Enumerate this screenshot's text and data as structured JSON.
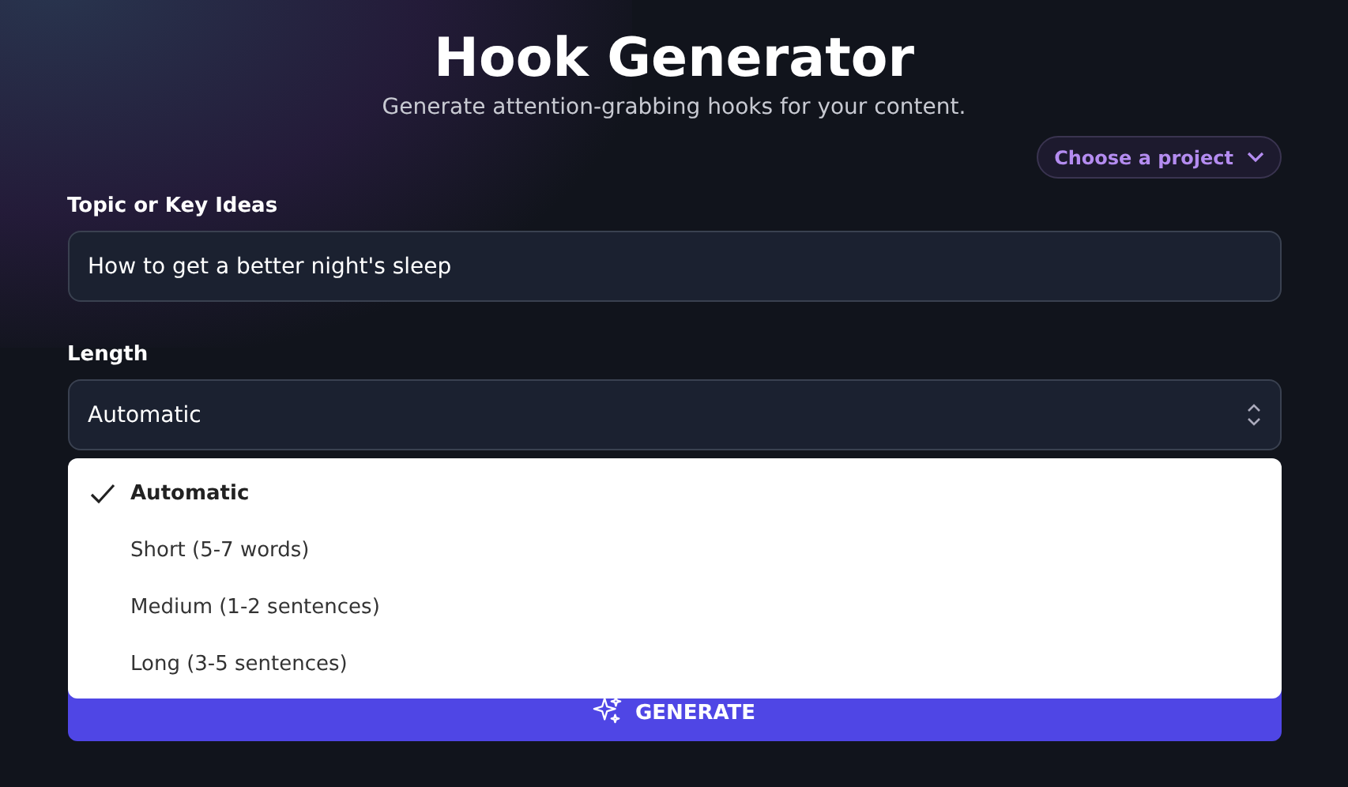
{
  "header": {
    "title": "Hook Generator",
    "subtitle": "Generate attention-grabbing hooks for your content."
  },
  "project_button": {
    "label": "Choose a project"
  },
  "topic": {
    "label": "Topic or Key Ideas",
    "value": "How to get a better night's sleep"
  },
  "length": {
    "label": "Length",
    "value": "Automatic",
    "expanded": true,
    "options": [
      {
        "label": "Automatic",
        "selected": true
      },
      {
        "label": "Short (5-7 words)",
        "selected": false
      },
      {
        "label": "Medium (1-2 sentences)",
        "selected": false
      },
      {
        "label": "Long (3-5 sentences)",
        "selected": false
      }
    ]
  },
  "generate_button": {
    "label": "GENERATE"
  }
}
